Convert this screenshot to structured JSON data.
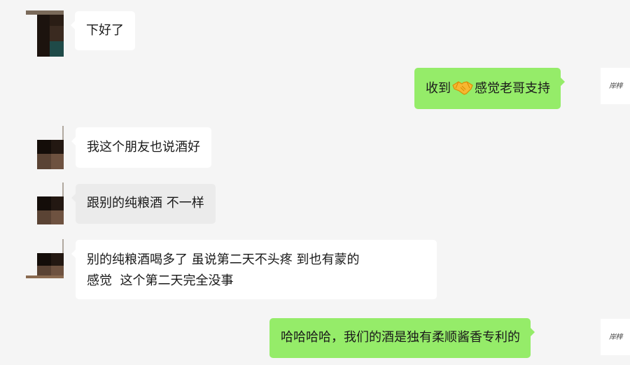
{
  "chat": {
    "messages": [
      {
        "id": 1,
        "side": "received",
        "text": "下好了"
      },
      {
        "id": 2,
        "side": "sent",
        "text_before": "收到",
        "emoji": "handshake-icon",
        "text_after": "感觉老哥支持"
      },
      {
        "id": 3,
        "side": "received",
        "text": "我这个朋友也说酒好"
      },
      {
        "id": 4,
        "side": "received",
        "text": "跟别的纯粮酒 不一样",
        "highlighted": true
      },
      {
        "id": 5,
        "side": "received",
        "line1": "别的纯粮酒喝多了 虽说第二天不头疼 到也有蒙的",
        "line2": "感觉  这个第二天完全没事"
      },
      {
        "id": 6,
        "side": "sent",
        "text": "哈哈哈哈，我们的酒是独有柔顺酱香专利的"
      }
    ],
    "self_avatar_text": "岸梓"
  },
  "colors": {
    "background": "#f5f5f5",
    "received_bubble": "#ffffff",
    "received_bubble_highlight": "#ebebeb",
    "sent_bubble": "#95ec69",
    "text": "#1a1a1a"
  }
}
